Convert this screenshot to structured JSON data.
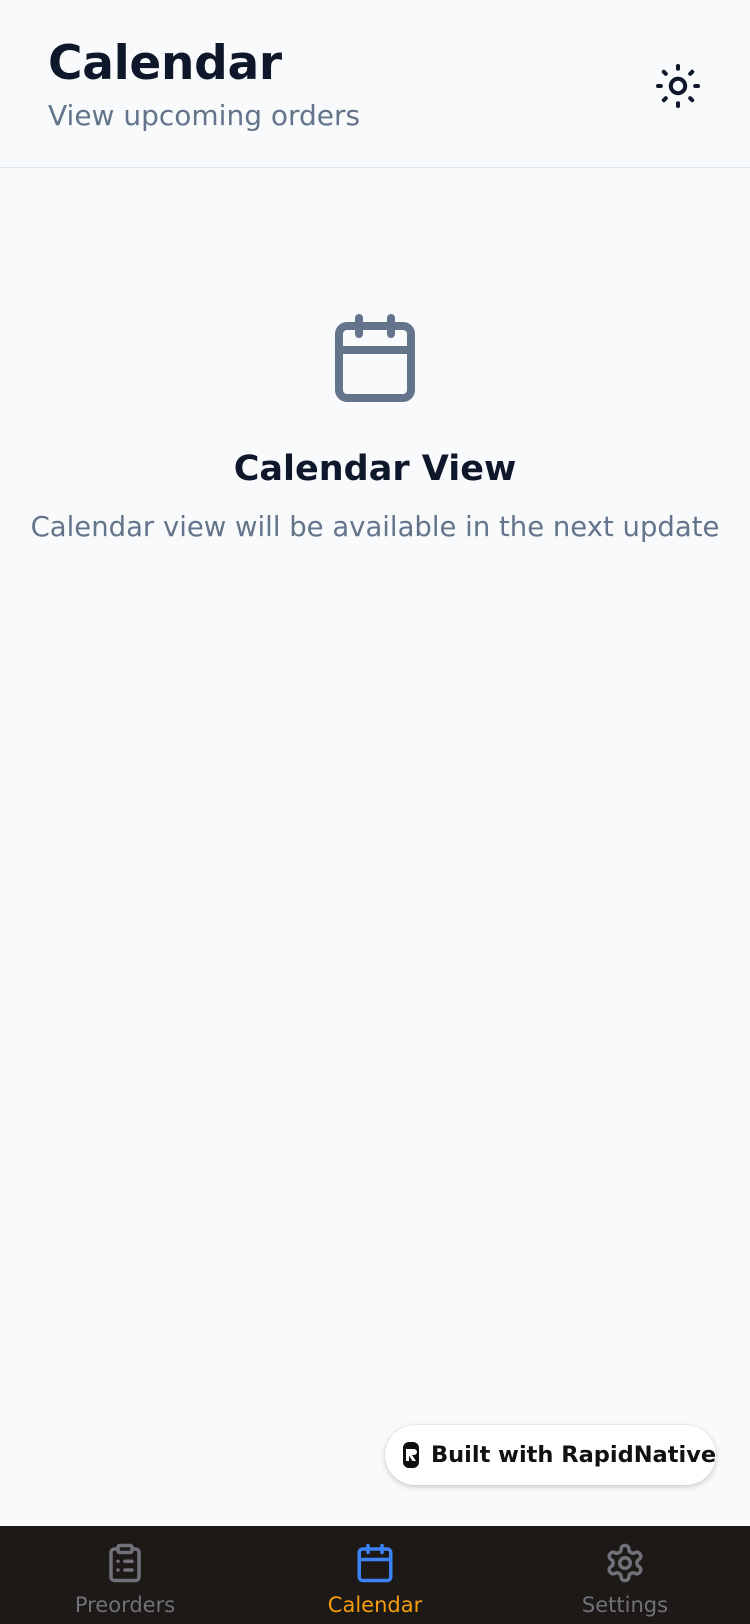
{
  "header": {
    "title": "Calendar",
    "subtitle": "View upcoming orders",
    "theme_toggle_icon": "sun-icon"
  },
  "empty_state": {
    "icon": "calendar-icon",
    "title": "Calendar View",
    "description": "Calendar view will be available in the next update"
  },
  "badge": {
    "icon": "rapidnative-logo-icon",
    "label": "Built with RapidNative"
  },
  "tabs": [
    {
      "label": "Preorders",
      "icon": "clipboard-list-icon",
      "active": false
    },
    {
      "label": "Calendar",
      "icon": "calendar-icon",
      "active": true
    },
    {
      "label": "Settings",
      "icon": "gear-icon",
      "active": false
    }
  ],
  "colors": {
    "active_tab_icon": "#3b82f6",
    "active_tab_label": "#f59e0b",
    "inactive_tab": "#71717a",
    "tab_bar_background": "#1c1917",
    "page_background": "#f8fafc",
    "heading": "#0f172a",
    "muted_text": "#64748b",
    "empty_icon": "#64748b"
  }
}
